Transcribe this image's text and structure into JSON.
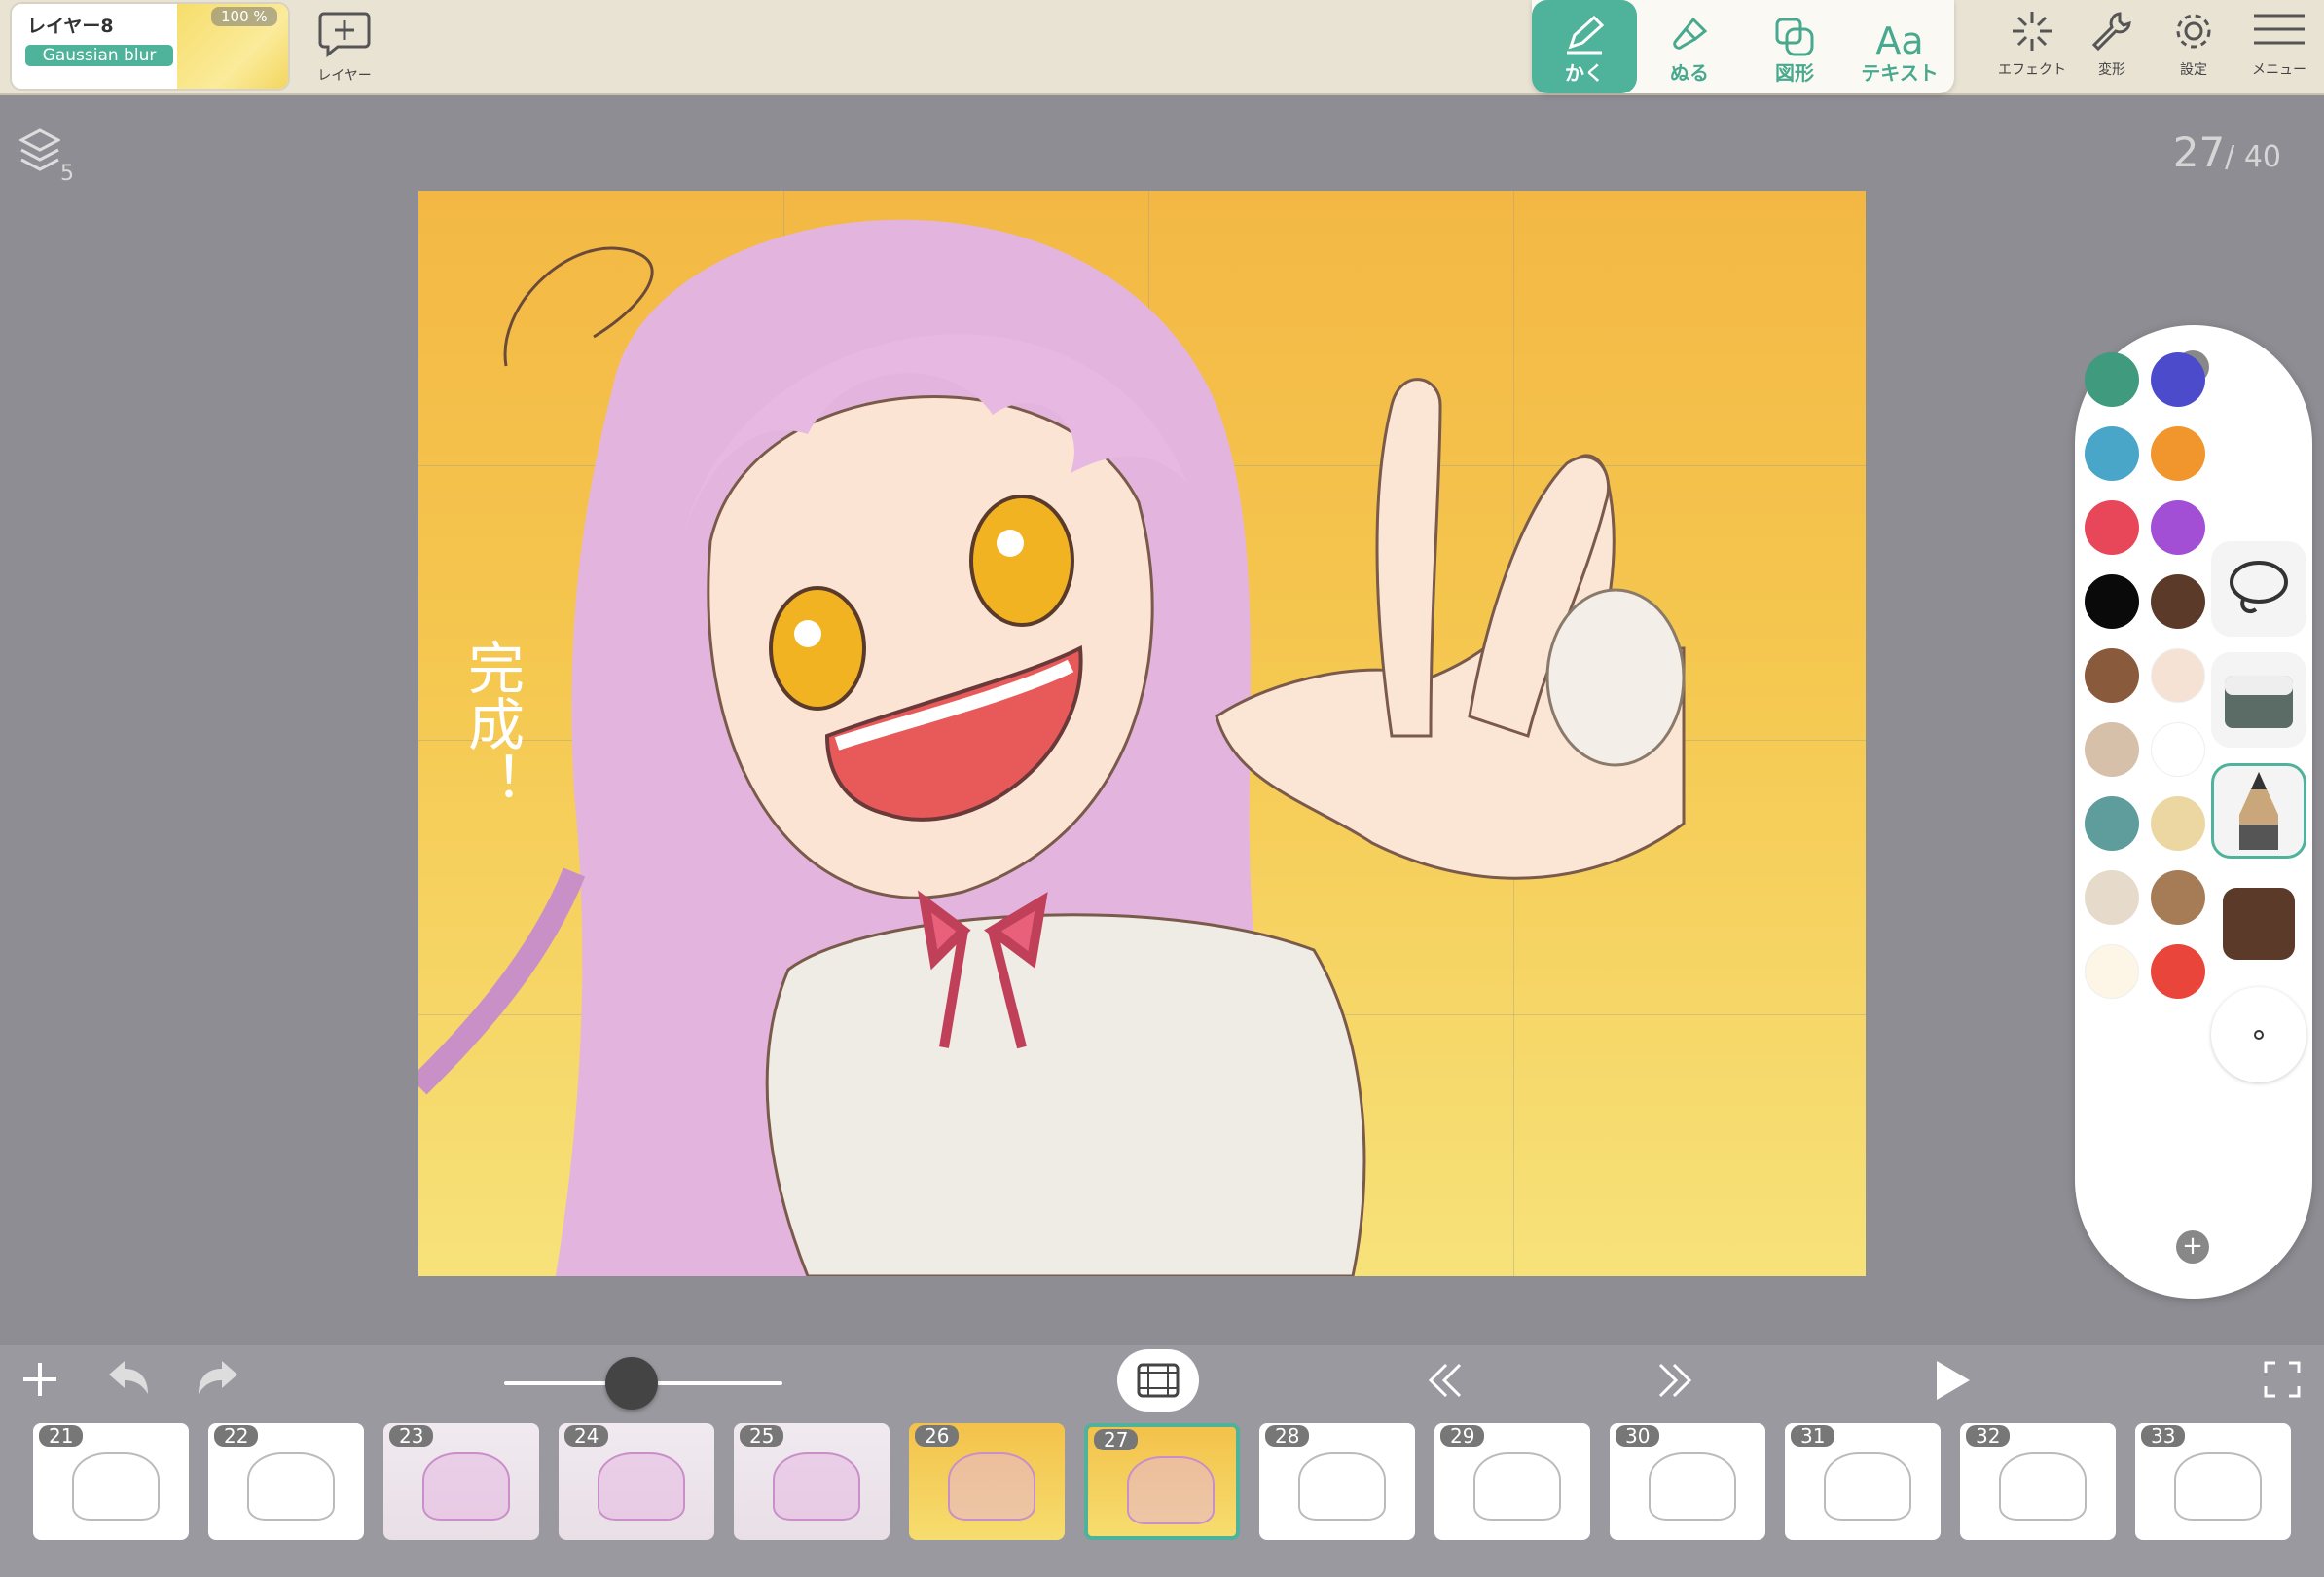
{
  "toolbar": {
    "layer": {
      "name": "レイヤー8",
      "effect": "Gaussian blur",
      "opacity": "100 %"
    },
    "add_layer_label": "レイヤー",
    "modes": [
      {
        "label": "かく",
        "icon": "pencil-icon",
        "active": true
      },
      {
        "label": "ぬる",
        "icon": "brush-icon",
        "active": false
      },
      {
        "label": "図形",
        "icon": "shapes-icon",
        "active": false
      },
      {
        "label": "テキスト",
        "icon": "text-icon",
        "active": false
      }
    ],
    "effect_label": "エフェクト",
    "transform_label": "変形",
    "settings_label": "設定",
    "menu_label": "メニュー"
  },
  "layers_indicator": {
    "count": "5"
  },
  "frame_counter": {
    "current": "27",
    "total": "/ 40"
  },
  "canvas": {
    "handwritten_text": "完成！"
  },
  "palette": {
    "colors": [
      "#3f9a7e",
      "#4b4bcc",
      "#4aa6c9",
      "#f0962d",
      "#e8475a",
      "#a24fd6",
      "#0a0a0a",
      "#5b3a2a",
      "#8a5a3d",
      "#f6e2d5",
      "#d7c0a9",
      "#ffffff",
      "#5e9d9c",
      "#ecd7a3",
      "#e6dbcb",
      "#a57c56",
      "#fdf6e7",
      "#e9453a"
    ],
    "tools": [
      "lasso-icon",
      "eraser-icon",
      "pencil-tool-icon",
      "current-color-swatch",
      "brush-size-dot"
    ],
    "current_color": "#5b3a2a"
  },
  "timeline": {
    "frames": [
      {
        "n": "21",
        "style": "sketch"
      },
      {
        "n": "22",
        "style": "sketch"
      },
      {
        "n": "23",
        "style": "colored"
      },
      {
        "n": "24",
        "style": "colored"
      },
      {
        "n": "25",
        "style": "colored"
      },
      {
        "n": "26",
        "style": "yellow"
      },
      {
        "n": "27",
        "style": "yellow-selected"
      },
      {
        "n": "28",
        "style": "sketch"
      },
      {
        "n": "29",
        "style": "sketch"
      },
      {
        "n": "30",
        "style": "sketch"
      },
      {
        "n": "31",
        "style": "sketch"
      },
      {
        "n": "32",
        "style": "sketch"
      },
      {
        "n": "33",
        "style": "sketch"
      }
    ],
    "onion_skin": 0.45
  }
}
